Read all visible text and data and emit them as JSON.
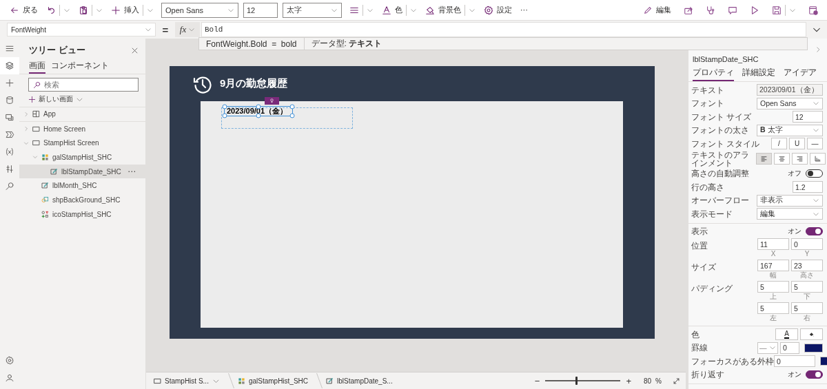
{
  "toolbar": {
    "left": [
      {
        "kind": "back",
        "label": "戻る"
      },
      {
        "kind": "undo",
        "caret": true
      },
      {
        "kind": "paste",
        "caret": true
      },
      {
        "kind": "insert",
        "label": "挿入",
        "caret": true
      },
      {
        "kind": "select",
        "value": "Open Sans"
      },
      {
        "kind": "input",
        "value": "12"
      },
      {
        "kind": "select",
        "value": "太字"
      },
      {
        "kind": "align",
        "caret": true
      },
      {
        "kind": "fontcolor",
        "label": "色",
        "caret": true
      },
      {
        "kind": "fill",
        "label": "背景色",
        "caret": true
      },
      {
        "kind": "settings",
        "label": "設定"
      },
      {
        "kind": "more",
        "label": "⋯"
      }
    ],
    "right": [
      {
        "kind": "edit",
        "label": "編集"
      },
      {
        "kind": "share"
      },
      {
        "kind": "checker"
      },
      {
        "kind": "comment"
      },
      {
        "kind": "play"
      },
      {
        "kind": "save",
        "caret": true
      },
      {
        "kind": "publish"
      }
    ]
  },
  "formula_bar": {
    "property": "FontWeight",
    "equals": "=",
    "fx": "fx",
    "value": "Bold",
    "suggestion": {
      "expression": "FontWeight.Bold  =  bold",
      "type": "データ型: **テキスト**"
    }
  },
  "tree_panel": {
    "title": "ツリー ビュー",
    "tabs": [
      {
        "label": "画面",
        "selected": true
      },
      {
        "label": "コンポーネント",
        "selected": false
      }
    ],
    "search": {
      "placeholder": "検索"
    },
    "new_screen": "新しい画面",
    "items": [
      {
        "kind": "app",
        "label": "App",
        "expanded": false,
        "selected": false
      },
      {
        "kind": "screen",
        "label": "Home Screen",
        "expanded": false,
        "selected": false
      },
      {
        "kind": "screen",
        "label": "StampHist Screen",
        "expanded": true,
        "selected": false,
        "children": [
          {
            "kind": "gallery",
            "label": "galStampHist_SHC",
            "expanded": true,
            "selected": false,
            "children": [
              {
                "kind": "label",
                "label": "lblStampDate_SHC",
                "selected": true,
                "more": "⋯"
              }
            ]
          },
          {
            "kind": "label",
            "label": "lblMonth_SHC",
            "selected": false
          },
          {
            "kind": "shape",
            "label": "shpBackGround_SHC",
            "selected": false
          },
          {
            "kind": "icon",
            "label": "icoStampHist_SHC",
            "selected": false
          }
        ]
      }
    ]
  },
  "rail": [
    {
      "kind": "menu",
      "selected": false
    },
    {
      "kind": "tree",
      "selected": true
    },
    {
      "kind": "insert",
      "selected": false
    },
    {
      "kind": "data",
      "selected": false
    },
    {
      "kind": "media",
      "selected": false
    },
    {
      "kind": "flow",
      "selected": false
    },
    {
      "kind": "variables",
      "selected": false
    },
    {
      "kind": "tools",
      "selected": false
    },
    {
      "kind": "search",
      "selected": false
    }
  ],
  "rail_bottom": [
    {
      "kind": "settings",
      "selected": false
    },
    {
      "kind": "account",
      "selected": false
    }
  ],
  "canvas": {
    "title": "9月の勤怠履歴",
    "label_text": "2023/09/01（金）"
  },
  "properties": {
    "control_name": "lblStampDate_SHC",
    "tabs": [
      {
        "label": "プロパティ",
        "selected": true
      },
      {
        "label": "詳細設定",
        "selected": false
      },
      {
        "label": "アイデア",
        "selected": false
      }
    ],
    "groups": [
      [
        {
          "kind": "readonly",
          "label": "テキスト",
          "value": "2023/09/01（金）"
        },
        {
          "kind": "select",
          "label": "フォント",
          "value": "Open Sans"
        },
        {
          "kind": "number",
          "label": "フォント サイズ",
          "value": "12"
        },
        {
          "kind": "select",
          "label": "フォントの太さ",
          "value": "**B**  太字"
        },
        {
          "kind": "buttons",
          "label": "フォント スタイル",
          "buttons": [
            {
              "label": "/",
              "selected": false
            },
            {
              "label": "U",
              "selected": false
            },
            {
              "label": "—",
              "selected": false
            }
          ]
        },
        {
          "kind": "align",
          "label": "テキストのアラインメント",
          "buttons": [
            {
              "kind": "left",
              "selected": true
            },
            {
              "kind": "center",
              "selected": false
            },
            {
              "kind": "right",
              "selected": false
            },
            {
              "kind": "bottom",
              "selected": false
            }
          ]
        },
        {
          "kind": "toggle",
          "label": "高さの自動調整",
          "state": "オフ",
          "on": false
        },
        {
          "kind": "number",
          "label": "行の高さ",
          "value": "1.2"
        },
        {
          "kind": "select",
          "label": "オーバーフロー",
          "value": "非表示"
        },
        {
          "kind": "select",
          "label": "表示モード",
          "value": "編集"
        }
      ],
      [
        {
          "kind": "toggle",
          "label": "表示",
          "state": "オン",
          "on": true
        },
        {
          "kind": "pair",
          "label": "位置",
          "fields": [
            {
              "value": "11",
              "caption": "X"
            },
            {
              "value": "0",
              "caption": "Y"
            }
          ]
        },
        {
          "kind": "pair",
          "label": "サイズ",
          "fields": [
            {
              "value": "167",
              "caption": "幅"
            },
            {
              "value": "23",
              "caption": "高さ"
            }
          ]
        },
        {
          "kind": "pair",
          "label": "パディング",
          "fields": [
            {
              "value": "5",
              "caption": "上"
            },
            {
              "value": "5",
              "caption": "下"
            }
          ]
        },
        {
          "kind": "pair",
          "fields": [
            {
              "value": "5",
              "caption": "左"
            },
            {
              "value": "5",
              "caption": "右"
            }
          ]
        }
      ],
      [
        {
          "kind": "colors",
          "label": "色",
          "text_button": "A"
        },
        {
          "kind": "border",
          "label": "罫線",
          "style": "—",
          "value": "0",
          "color": "#0b1565"
        },
        {
          "kind": "focus",
          "label": "フォーカスがある外枠",
          "value": "0",
          "color": "#0b1565"
        },
        {
          "kind": "toggle",
          "label": "折り返す",
          "state": "オン",
          "on": true
        }
      ]
    ]
  },
  "status_bar": {
    "breadcrumbs": [
      {
        "kind": "screen",
        "label": "StampHist S...",
        "caret": true
      },
      {
        "kind": "gallery",
        "label": "galStampHist_SHC"
      },
      {
        "kind": "label",
        "label": "lblStampDate_S..."
      }
    ],
    "zoom_out": "−",
    "zoom_in": "+",
    "zoom": {
      "level": 0.4
    },
    "zoom_value": "80",
    "zoom_unit": "%"
  }
}
